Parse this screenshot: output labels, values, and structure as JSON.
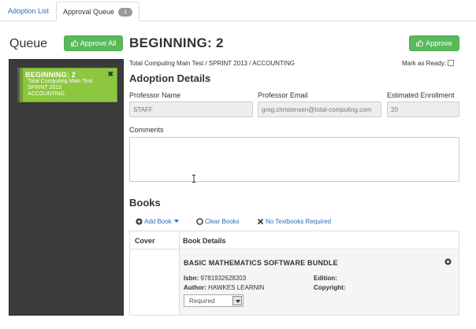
{
  "tabs": [
    {
      "label": "Adoption List"
    },
    {
      "label": "Approval Queue",
      "badge": "1"
    }
  ],
  "queue": {
    "title": "Queue",
    "approve_all_label": "Approve All",
    "item": {
      "title": "BEGINNING: 2",
      "line1": "Total Computing Main Test",
      "line2": "SPRINT 2013",
      "line3": "ACCOUNTING",
      "close": "✖"
    }
  },
  "main": {
    "title": "BEGINNING: 2",
    "approve_label": "Approve",
    "breadcrumb": "Total Computing Main Test / SPRINT 2013 / ACCOUNTING",
    "mark_ready_label": "Mark as Ready:"
  },
  "adoption_details": {
    "title": "Adoption Details",
    "professor_name_label": "Professor Name",
    "professor_name_value": "STAFF",
    "professor_email_label": "Professor Email",
    "professor_email_value": "greg.christensen@total-computing.com",
    "enrollment_label": "Estimated Enrollment",
    "enrollment_value": "20",
    "comments_label": "Comments",
    "comments_value": ""
  },
  "books": {
    "title": "Books",
    "add_book_label": "Add Book",
    "clear_books_label": "Clear Books",
    "no_textbooks_label": "No Textbooks Required",
    "col_cover": "Cover",
    "col_details": "Book Details",
    "items": [
      {
        "title": "BASIC MATHEMATICS SOFTWARE BUNDLE",
        "isbn_label": "Isbn:",
        "isbn": "9781932628203",
        "author_label": "Author:",
        "author": "HAWKES LEARNIN",
        "edition_label": "Edition:",
        "edition": "",
        "copyright_label": "Copyright:",
        "copyright": "",
        "requirement": "Required"
      }
    ]
  },
  "colors": {
    "brand_green": "#5cb85c",
    "queue_item_green": "#8dc63f",
    "link_blue": "#2a6db5",
    "queue_panel_bg": "#3b3b3b"
  },
  "icons": [
    "thumbs-up-icon",
    "close-icon",
    "plus-circle-icon",
    "clear-circle-icon",
    "x-icon",
    "remove-circle-icon",
    "chevron-down-icon",
    "text-cursor-icon"
  ]
}
